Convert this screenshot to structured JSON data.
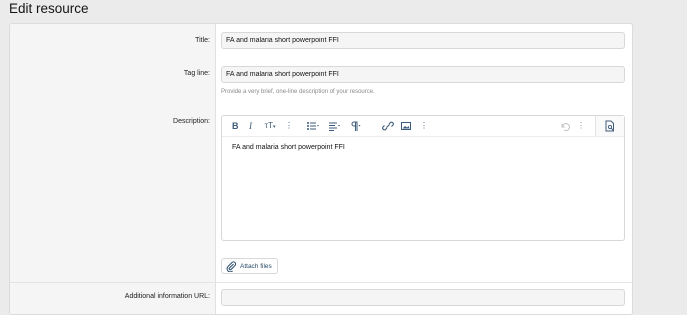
{
  "page": {
    "title": "Edit resource"
  },
  "form": {
    "title_label": "Title:",
    "title_value": "FA and malaria short powerpoint FFI",
    "tagline_label": "Tag line:",
    "tagline_value": "FA and malaria short powerpoint FFI",
    "tagline_hint": "Provide a very brief, one-line description of your resource.",
    "description_label": "Description:",
    "description_value": "FA and malaria short powerpoint FFI",
    "attach_label": "Attach files",
    "additional_url_label": "Additional information URL:"
  },
  "toolbar": {
    "bold": "B",
    "italic": "I",
    "font_size": "тТ",
    "more": "⋮"
  },
  "colors": {
    "accent": "#2b4a69",
    "page_bg": "#ebebeb",
    "panel_bg": "#f5f5f5"
  }
}
